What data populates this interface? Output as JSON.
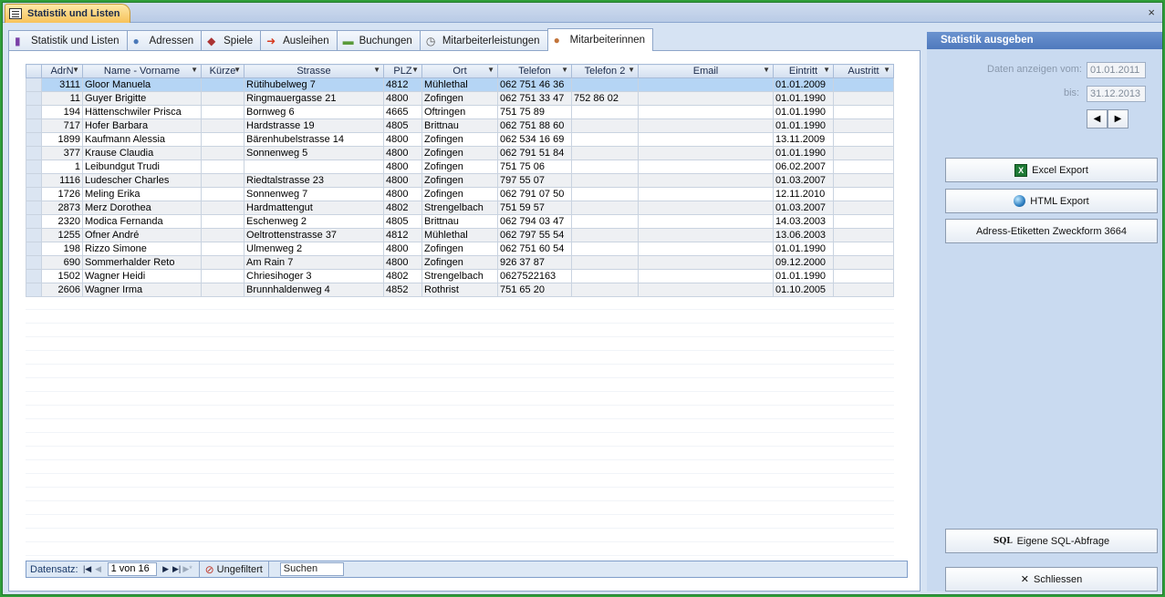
{
  "window": {
    "doc_tab_title": "Statistik und Listen",
    "close_glyph": "×"
  },
  "tabs": [
    {
      "label": "Statistik und Listen",
      "icon": "chart-icon",
      "active": false
    },
    {
      "label": "Adressen",
      "icon": "person-icon",
      "active": false
    },
    {
      "label": "Spiele",
      "icon": "dice-icon",
      "active": false
    },
    {
      "label": "Ausleihen",
      "icon": "arrow-right-icon",
      "active": false
    },
    {
      "label": "Buchungen",
      "icon": "money-icon",
      "active": false
    },
    {
      "label": "Mitarbeiterleistungen",
      "icon": "clock-icon",
      "active": false
    },
    {
      "label": "Mitarbeiterinnen",
      "icon": "woman-icon",
      "active": true
    }
  ],
  "grid": {
    "columns": [
      "AdrN",
      "Name - Vorname",
      "Kürze",
      "Strasse",
      "PLZ",
      "Ort",
      "Telefon",
      "Telefon 2",
      "Email",
      "Eintritt",
      "Austritt"
    ],
    "rows": [
      [
        "3111",
        "Gloor Manuela",
        "",
        "Rütihubelweg 7",
        "4812",
        "Mühlethal",
        "062 751 46 36",
        "",
        "",
        "01.01.2009",
        ""
      ],
      [
        "11",
        "Guyer Brigitte",
        "",
        "Ringmauergasse 21",
        "4800",
        "Zofingen",
        "062 751 33 47",
        "752 86 02",
        "",
        "01.01.1990",
        ""
      ],
      [
        "194",
        "Hättenschwiler Prisca",
        "",
        "Bornweg 6",
        "4665",
        "Oftringen",
        "751 75 89",
        "",
        "",
        "01.01.1990",
        ""
      ],
      [
        "717",
        "Hofer Barbara",
        "",
        "Hardstrasse 19",
        "4805",
        "Brittnau",
        "062  751 88 60",
        "",
        "",
        "01.01.1990",
        ""
      ],
      [
        "1899",
        "Kaufmann Alessia",
        "",
        "Bärenhubelstrasse 14",
        "4800",
        "Zofingen",
        "062  534 16 69",
        "",
        "",
        "13.11.2009",
        ""
      ],
      [
        "377",
        "Krause Claudia",
        "",
        "Sonnenweg 5",
        "4800",
        "Zofingen",
        "062 791 51 84",
        "",
        "",
        "01.01.1990",
        ""
      ],
      [
        "1",
        "Leibundgut Trudi",
        "",
        "",
        "4800",
        "Zofingen",
        "751 75 06",
        "",
        "",
        "06.02.2007",
        ""
      ],
      [
        "1116",
        "Ludescher Charles",
        "",
        "Riedtalstrasse 23",
        "4800",
        "Zofingen",
        "797 55 07",
        "",
        "",
        "01.03.2007",
        ""
      ],
      [
        "1726",
        "Meling Erika",
        "",
        "Sonnenweg 7",
        "4800",
        "Zofingen",
        "062 791 07 50",
        "",
        "",
        "12.11.2010",
        ""
      ],
      [
        "2873",
        "Merz Dorothea",
        "",
        "Hardmattengut",
        "4802",
        "Strengelbach",
        "751 59 57",
        "",
        "",
        "01.03.2007",
        ""
      ],
      [
        "2320",
        "Modica Fernanda",
        "",
        "Eschenweg 2",
        "4805",
        "Brittnau",
        "062 794 03 47",
        "",
        "",
        "14.03.2003",
        ""
      ],
      [
        "1255",
        "Ofner André",
        "",
        "Oeltrottenstrasse 37",
        "4812",
        "Mühlethal",
        "062  797 55 54",
        "",
        "",
        "13.06.2003",
        ""
      ],
      [
        "198",
        "Rizzo Simone",
        "",
        "Ulmenweg 2",
        "4800",
        "Zofingen",
        "062  751 60 54",
        "",
        "",
        "01.01.1990",
        ""
      ],
      [
        "690",
        "Sommerhalder Reto",
        "",
        "Am Rain 7",
        "4800",
        "Zofingen",
        "926 37 87",
        "",
        "",
        "09.12.2000",
        ""
      ],
      [
        "1502",
        "Wagner Heidi",
        "",
        "Chriesihoger 3",
        "4802",
        "Strengelbach",
        "0627522163",
        "",
        "",
        "01.01.1990",
        ""
      ],
      [
        "2606",
        "Wagner Irma",
        "",
        "Brunnhaldenweg 4",
        "4852",
        "Rothrist",
        "751 65 20",
        "",
        "",
        "01.10.2005",
        ""
      ]
    ],
    "selected_row": 0
  },
  "navbar": {
    "label": "Datensatz:",
    "record": "1 von 16",
    "filter_label": "Ungefiltert",
    "search_label": "Suchen"
  },
  "sidebar": {
    "header": "Statistik ausgeben",
    "from_label": "Daten anzeigen vom:",
    "from_value": "01.01.2011",
    "to_label": "bis:",
    "to_value": "31.12.2013",
    "excel_label": "Excel Export",
    "html_label": "HTML Export",
    "labels_label": "Adress-Etiketten Zweckform 3664",
    "sql_label": "Eigene SQL-Abfrage",
    "sql_icon_text": "SQL",
    "close_label": "Schliessen"
  }
}
